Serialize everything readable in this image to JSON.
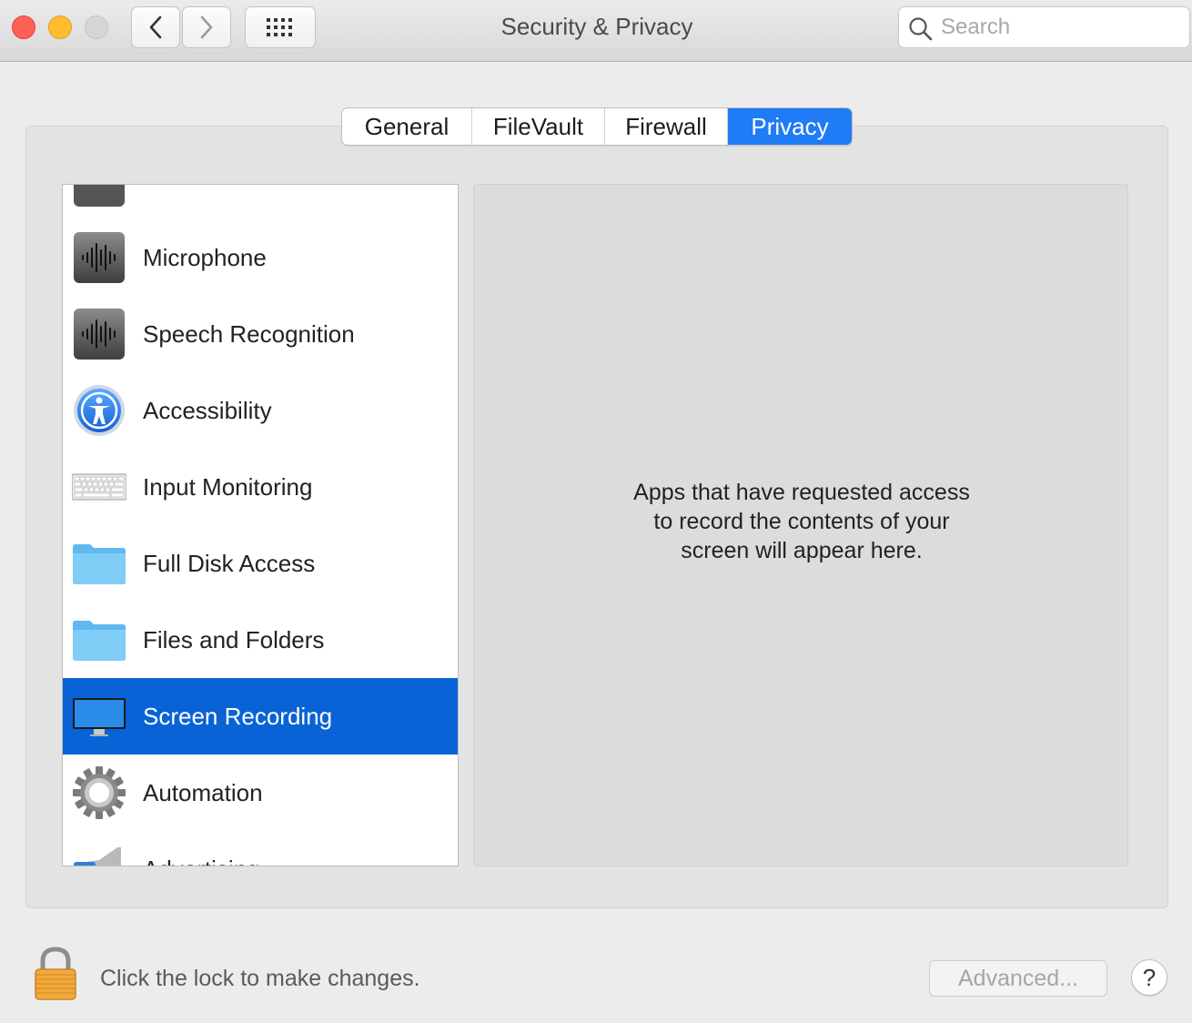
{
  "window": {
    "title": "Security & Privacy"
  },
  "toolbar": {
    "search_placeholder": "Search"
  },
  "tabs": [
    {
      "label": "General",
      "active": false
    },
    {
      "label": "FileVault",
      "active": false
    },
    {
      "label": "Firewall",
      "active": false
    },
    {
      "label": "Privacy",
      "active": true
    }
  ],
  "privacy_list": {
    "items": [
      {
        "label": "",
        "icon": "partial-icon"
      },
      {
        "label": "Microphone",
        "icon": "microphone-waveform-icon"
      },
      {
        "label": "Speech Recognition",
        "icon": "speech-waveform-icon"
      },
      {
        "label": "Accessibility",
        "icon": "accessibility-icon"
      },
      {
        "label": "Input Monitoring",
        "icon": "keyboard-icon"
      },
      {
        "label": "Full Disk Access",
        "icon": "folder-icon"
      },
      {
        "label": "Files and Folders",
        "icon": "folder-icon"
      },
      {
        "label": "Screen Recording",
        "icon": "display-icon",
        "selected": true
      },
      {
        "label": "Automation",
        "icon": "gear-icon"
      },
      {
        "label": "Advertising",
        "icon": "megaphone-icon"
      }
    ]
  },
  "detail": {
    "message_line1": "Apps that have requested access",
    "message_line2": "to record the contents of your",
    "message_line3": "screen will appear here."
  },
  "footer": {
    "lock_text": "Click the lock to make changes.",
    "advanced_label": "Advanced...",
    "help_label": "?"
  },
  "colors": {
    "accent": "#1f7bf6",
    "selection": "#0a63d6",
    "close": "#fe5f57",
    "minimize": "#febc2e"
  }
}
